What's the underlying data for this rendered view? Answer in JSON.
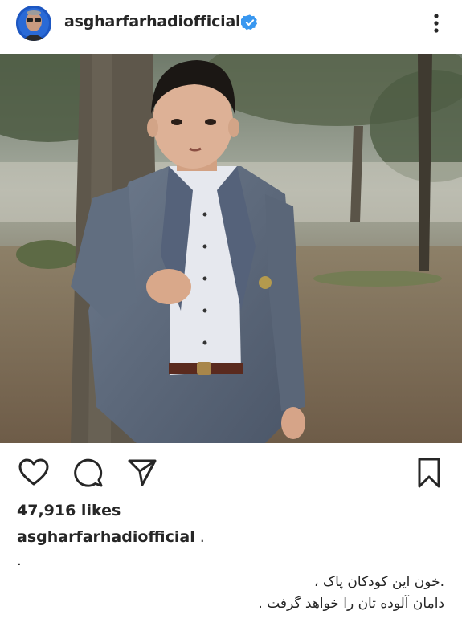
{
  "header": {
    "username": "asgharfarhadiofficial",
    "verified": true,
    "more_icon": "more-vertical-icon"
  },
  "post": {
    "image_description_icon": "post-photo"
  },
  "actions": {
    "like_icon": "heart-icon",
    "comment_icon": "comment-icon",
    "share_icon": "send-icon",
    "save_icon": "bookmark-icon"
  },
  "likes": "47,916 likes",
  "caption": {
    "username": "asgharfarhadiofficial",
    "suffix": " .",
    "dot_line": ".",
    "lines": [
      ".خون این کودکان پاک ،",
      "دامان آلوده تان را خواهد گرفت ."
    ]
  },
  "colors": {
    "text": "#262626",
    "verified": "#3897f0",
    "avatar_bg": "#1b4fb0"
  }
}
